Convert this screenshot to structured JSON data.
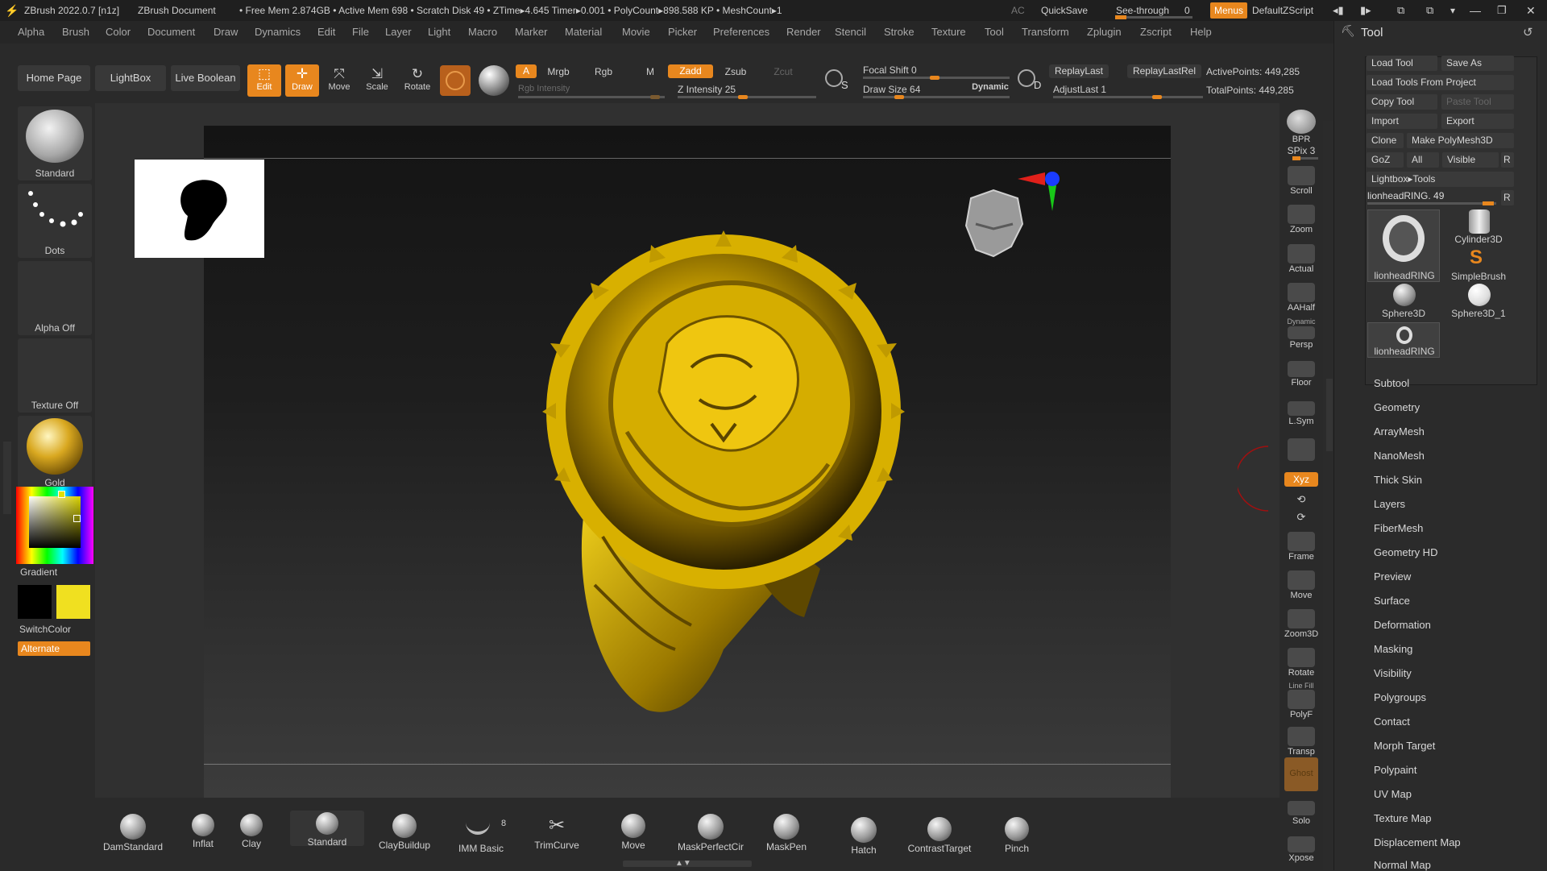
{
  "titlebar": {
    "app": "ZBrush 2022.0.7 [n1z]",
    "doc": "ZBrush Document",
    "status": "• Free Mem 2.874GB • Active Mem 698 • Scratch Disk 49 • ZTime▸4.645 Timer▸0.001 • PolyCount▸898.588 KP • MeshCount▸1",
    "ac": "AC",
    "quicksave": "QuickSave",
    "seethrough": "See-through",
    "seethrough_value": "0",
    "menus": "Menus",
    "defaultzscript": "DefaultZScript"
  },
  "menubar": [
    "Alpha",
    "Brush",
    "Color",
    "Document",
    "Draw",
    "Dynamics",
    "Edit",
    "File",
    "Layer",
    "Light",
    "Macro",
    "Marker",
    "Material",
    "Movie",
    "Picker",
    "Preferences",
    "Render",
    "Stencil",
    "Stroke",
    "Texture",
    "Tool",
    "Transform",
    "Zplugin",
    "Zscript",
    "Help"
  ],
  "toolbar": {
    "home": "Home Page",
    "lightbox": "LightBox",
    "liveboolean": "Live Boolean",
    "edit": "Edit",
    "draw": "Draw",
    "move": "Move",
    "scale": "Scale",
    "rotate": "Rotate",
    "a": "A",
    "mrgb": "Mrgb",
    "rgb": "Rgb",
    "m": "M",
    "zadd": "Zadd",
    "zsub": "Zsub",
    "zcut": "Zcut",
    "rgb_intensity": "Rgb Intensity",
    "z_intensity": "Z Intensity 25",
    "focal_shift": "Focal Shift 0",
    "draw_size": "Draw Size 64",
    "dynamic": "Dynamic",
    "replaylast": "ReplayLast",
    "replaylastrel": "ReplayLastRel",
    "adjustlast": "AdjustLast 1",
    "activepoints": "ActivePoints: 449,285",
    "totalpoints": "TotalPoints: 449,285",
    "s_label": "S",
    "d_label": "D"
  },
  "leftshelf": {
    "standard": "Standard",
    "dots": "Dots",
    "alpha": "Alpha Off",
    "texture": "Texture Off",
    "material": "Gold",
    "gradient": "Gradient",
    "switchcolor": "SwitchColor",
    "alternate": "Alternate",
    "primary_color": "#000000",
    "secondary_color": "#f0e020"
  },
  "rightshelf": [
    "BPR",
    "Scroll",
    "Zoom",
    "Actual",
    "AAHalf",
    "Persp",
    "Floor",
    "L.Sym",
    "",
    "Xyz",
    "",
    "",
    "Frame",
    "Move",
    "Zoom3D",
    "Rotate",
    "PolyF",
    "Transp",
    "Ghost",
    "Solo",
    "Xpose"
  ],
  "rightshelf_extra": {
    "spix": "SPix 3",
    "dynamic": "Dynamic",
    "linefill": "Line Fill"
  },
  "toolpanel": {
    "title": "Tool",
    "load_tool": "Load Tool",
    "save_as": "Save As",
    "load_from_project": "Load Tools From Project",
    "copy_tool": "Copy Tool",
    "paste_tool": "Paste Tool",
    "import": "Import",
    "export": "Export",
    "clone": "Clone",
    "make_polymesh": "Make PolyMesh3D",
    "goz": "GoZ",
    "all": "All",
    "visible": "Visible",
    "r": "R",
    "lightbox_tools": "Lightbox▸Tools",
    "current_tool": "lionheadRING. 49",
    "thumbs": [
      "lionheadRING",
      "Cylinder3D",
      "SimpleBrush",
      "Sphere3D",
      "Sphere3D_1",
      "lionheadRING"
    ],
    "subpalettes": [
      "Subtool",
      "Geometry",
      "ArrayMesh",
      "NanoMesh",
      "Thick Skin",
      "Layers",
      "FiberMesh",
      "Geometry HD",
      "Preview",
      "Surface",
      "Deformation",
      "Masking",
      "Visibility",
      "Polygroups",
      "Contact",
      "Morph Target",
      "Polypaint",
      "UV Map",
      "Texture Map",
      "Displacement Map",
      "Normal Map"
    ]
  },
  "bottom_brushes": [
    "DamStandard",
    "Inflat",
    "Clay",
    "Standard",
    "ClayBuildup",
    "IMM Basic",
    "TrimCurve",
    "Move",
    "MaskPerfectCir",
    "MaskPen",
    "Hatch",
    "ContrastTarget",
    "Pinch"
  ],
  "imm_count": "8"
}
